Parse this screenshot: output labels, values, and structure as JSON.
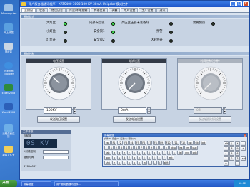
{
  "desktop": {
    "icons": [
      "Mycomputer",
      "网上邻居",
      "回收站",
      "Internet Explorer",
      "Excel 2003",
      "Word 2003",
      "远程桌面连接",
      "新建文件夹"
    ]
  },
  "window": {
    "title": "用户服务器通讯程序 - XRTS400 3000.100 KV 30mA Unipolar 模式控件",
    "buttons": [
      "_",
      "□",
      "×"
    ]
  },
  "tabs": [
    "主控窗",
    "状态",
    "错误日志",
    "灯丝/本地控制",
    "其他信息",
    "调整",
    "用户设置",
    "工厂设置",
    "通讯"
  ],
  "status": {
    "header": "系统状态",
    "items": [
      {
        "label": "大灯丝",
        "on": true
      },
      {
        "label": "小灯丝",
        "on": false
      },
      {
        "label": "灯丝开",
        "on": false
      },
      {
        "label": "内部安全锁",
        "on": true
      },
      {
        "label": "安全锁1",
        "on": true
      },
      {
        "label": "安全锁2",
        "on": false
      },
      {
        "label": "高压变压器未准备好",
        "on": false
      },
      {
        "label": "预警",
        "on": false
      },
      {
        "label": "X射线开",
        "on": false
      },
      {
        "label": "需要预热",
        "on": false
      }
    ]
  },
  "controls": {
    "header": "系统控制",
    "voltage": {
      "title": "电压设置",
      "value": "100KV",
      "button": "发送电压设置",
      "knob_fraction": 0.33
    },
    "current": {
      "title": "电流设置",
      "value": "0mA",
      "button": "发送电流设置",
      "knob_fraction": 0.0
    },
    "time": {
      "title": "时间控制(分钟)",
      "value": "0S",
      "button": "发送辐照时间设置",
      "knob_fraction": 0.0
    }
  },
  "meter": {
    "header": "工作参数",
    "display": "0S KV",
    "rows": [
      "当前值",
      "X射线控制",
      "辐照时间"
    ],
    "footer": "8785A587"
  },
  "keyboard": {
    "title": "屏幕键盘",
    "menu": "文件(F)  键盘(K)  设置(S)  帮助(H)",
    "rows": [
      [
        "esc",
        "F1",
        "F2",
        "F3",
        "F4",
        "F5",
        "F6",
        "F7",
        "F8",
        "F9",
        "F10",
        "F11",
        "F12",
        "psc",
        "slk",
        "brk"
      ],
      [
        "`",
        "1",
        "2",
        "3",
        "4",
        "5",
        "6",
        "7",
        "8",
        "9",
        "0",
        "-",
        "=",
        "bksp",
        "ins",
        "hm",
        "pup"
      ],
      [
        "tab",
        "q",
        "w",
        "e",
        "r",
        "t",
        "y",
        "u",
        "i",
        "o",
        "p",
        "[",
        "]",
        "\\",
        "del",
        "end",
        "pdn"
      ],
      [
        "lock",
        "a",
        "s",
        "d",
        "f",
        "g",
        "h",
        "j",
        "k",
        "l",
        ";",
        "'",
        "ent"
      ],
      [
        "shft",
        "z",
        "x",
        "c",
        "v",
        "b",
        "n",
        "m",
        ",",
        ".",
        "/",
        "shft"
      ],
      [
        "ctrl",
        "win",
        "alt",
        "",
        "alt",
        "win",
        "ctrl"
      ]
    ],
    "numpad": [
      "nlk",
      "/",
      "*",
      "-",
      "7",
      "8",
      "9",
      "+",
      "4",
      "5",
      "6",
      "",
      "1",
      "2",
      "3",
      "ent",
      "0",
      "",
      ".",
      ""
    ]
  },
  "taskbar": {
    "start": "开始",
    "tasks": [
      "屏幕键盘",
      "用户服务器通讯程序..."
    ],
    "clock": "10:02"
  },
  "colors": {
    "lamp_on": "#38e04a",
    "lamp_off": "#2b3a2b",
    "title_bar": "#1d56c9"
  }
}
